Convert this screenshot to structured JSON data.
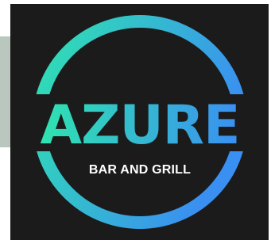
{
  "logo": {
    "brand_name": "AZURE",
    "tagline": "BAR AND GRILL"
  },
  "colors": {
    "background": "#1b1b1b",
    "side_strip": "#b9c7bf",
    "gradient_start": "#2fe3b0",
    "gradient_end": "#3a8ff2",
    "tagline_text": "#ffffff"
  }
}
